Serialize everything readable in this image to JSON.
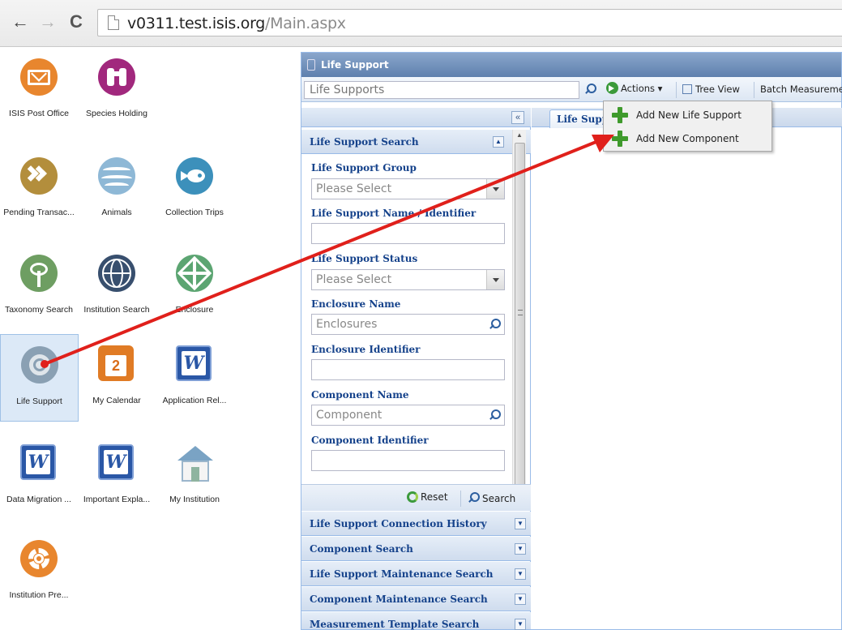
{
  "browser": {
    "url_host": "v0311.test.isis.org",
    "url_path": "/Main.aspx"
  },
  "desktop": {
    "items": [
      {
        "label": "ISIS Post Office",
        "icon": "envelope-icon"
      },
      {
        "label": "Species Holding",
        "icon": "binoculars-icon"
      },
      {
        "label": "Pending Transac...",
        "icon": "double-chevron-icon"
      },
      {
        "label": "Animals",
        "icon": "animals-icon"
      },
      {
        "label": "Collection Trips",
        "icon": "fish-icon"
      },
      {
        "label": "Taxonomy Search",
        "icon": "tree-icon"
      },
      {
        "label": "Institution Search",
        "icon": "globe-icon"
      },
      {
        "label": "Enclosure",
        "icon": "enclosure-icon"
      },
      {
        "label": "Life Support",
        "icon": "life-support-icon"
      },
      {
        "label": "My Calendar",
        "icon": "calendar-icon"
      },
      {
        "label": "Application Rel...",
        "icon": "word-doc-icon"
      },
      {
        "label": "Data Migration ...",
        "icon": "word-doc-icon"
      },
      {
        "label": "Important Expla...",
        "icon": "word-doc-icon"
      },
      {
        "label": "My Institution",
        "icon": "house-icon"
      },
      {
        "label": "Institution Pre...",
        "icon": "gear-icon"
      }
    ],
    "calendar_day": "2",
    "word_letter": "W"
  },
  "window": {
    "title": "Life Support",
    "search_value": "Life Supports",
    "toolbar": {
      "actions_label": "Actions ▾",
      "tree_view_label": "Tree View",
      "batch_label": "Batch Measuremen"
    }
  },
  "actions_menu": {
    "items": [
      "Add New Life Support",
      "Add New Component"
    ]
  },
  "panel": {
    "collapse_label": "«",
    "search_header": "Life Support Search",
    "fields": {
      "group_label": "Life Support Group",
      "group_value": "Please Select",
      "name_label": "Life Support Name / Identifier",
      "status_label": "Life Support Status",
      "status_value": "Please Select",
      "enclosure_name_label": "Enclosure Name",
      "enclosure_name_value": "Enclosures",
      "enclosure_id_label": "Enclosure Identifier",
      "component_name_label": "Component Name",
      "component_name_value": "Component",
      "component_id_label": "Component Identifier"
    },
    "buttons": {
      "reset": "Reset",
      "search": "Search"
    },
    "sections": [
      "Life Support Connection History",
      "Component Search",
      "Life Support Maintenance Search",
      "Component Maintenance Search",
      "Measurement Template Search"
    ]
  },
  "tabs": {
    "active_label": "Life Support"
  },
  "colors": {
    "panel_header_text": "#15428b",
    "annotation_arrow": "#e0201b",
    "plus_green": "#3f9a2c"
  }
}
